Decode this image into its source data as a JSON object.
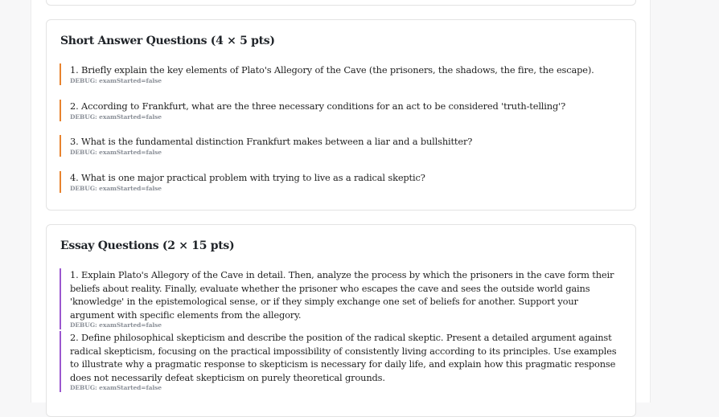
{
  "short_section": {
    "title": "Short Answer Questions (4 × 5 pts)",
    "questions": [
      {
        "text": "1. Briefly explain the key elements of Plato's Allegory of the Cave (the prisoners, the shadows, the fire, the escape).",
        "debug": "DEBUG: examStarted=false"
      },
      {
        "text": "2. According to Frankfurt, what are the three necessary conditions for an act to be considered 'truth-telling'?",
        "debug": "DEBUG: examStarted=false"
      },
      {
        "text": "3. What is the fundamental distinction Frankfurt makes between a liar and a bullshitter?",
        "debug": "DEBUG: examStarted=false"
      },
      {
        "text": "4. What is one major practical problem with trying to live as a radical skeptic?",
        "debug": "DEBUG: examStarted=false"
      }
    ]
  },
  "essay_section": {
    "title": "Essay Questions (2 × 15 pts)",
    "questions": [
      {
        "text": "1. Explain Plato's Allegory of the Cave in detail. Then, analyze the process by which the prisoners in the cave form their beliefs about reality. Finally, evaluate whether the prisoner who escapes the cave and sees the outside world gains 'knowledge' in the epistemological sense, or if they simply exchange one set of beliefs for another. Support your argument with specific elements from the allegory.",
        "debug": "DEBUG: examStarted=false"
      },
      {
        "text": "2. Define philosophical skepticism and describe the position of the radical skeptic. Present a detailed argument against radical skepticism, focusing on the practical impossibility of consistently living according to its principles. Use examples to illustrate why a pragmatic response to skepticism is necessary for daily life, and explain how this pragmatic response does not necessarily defeat skepticism on purely theoretical grounds.",
        "debug": "DEBUG: examStarted=false"
      }
    ]
  },
  "colors": {
    "short_accent": "#e8832e",
    "essay_accent": "#9b57cf"
  }
}
